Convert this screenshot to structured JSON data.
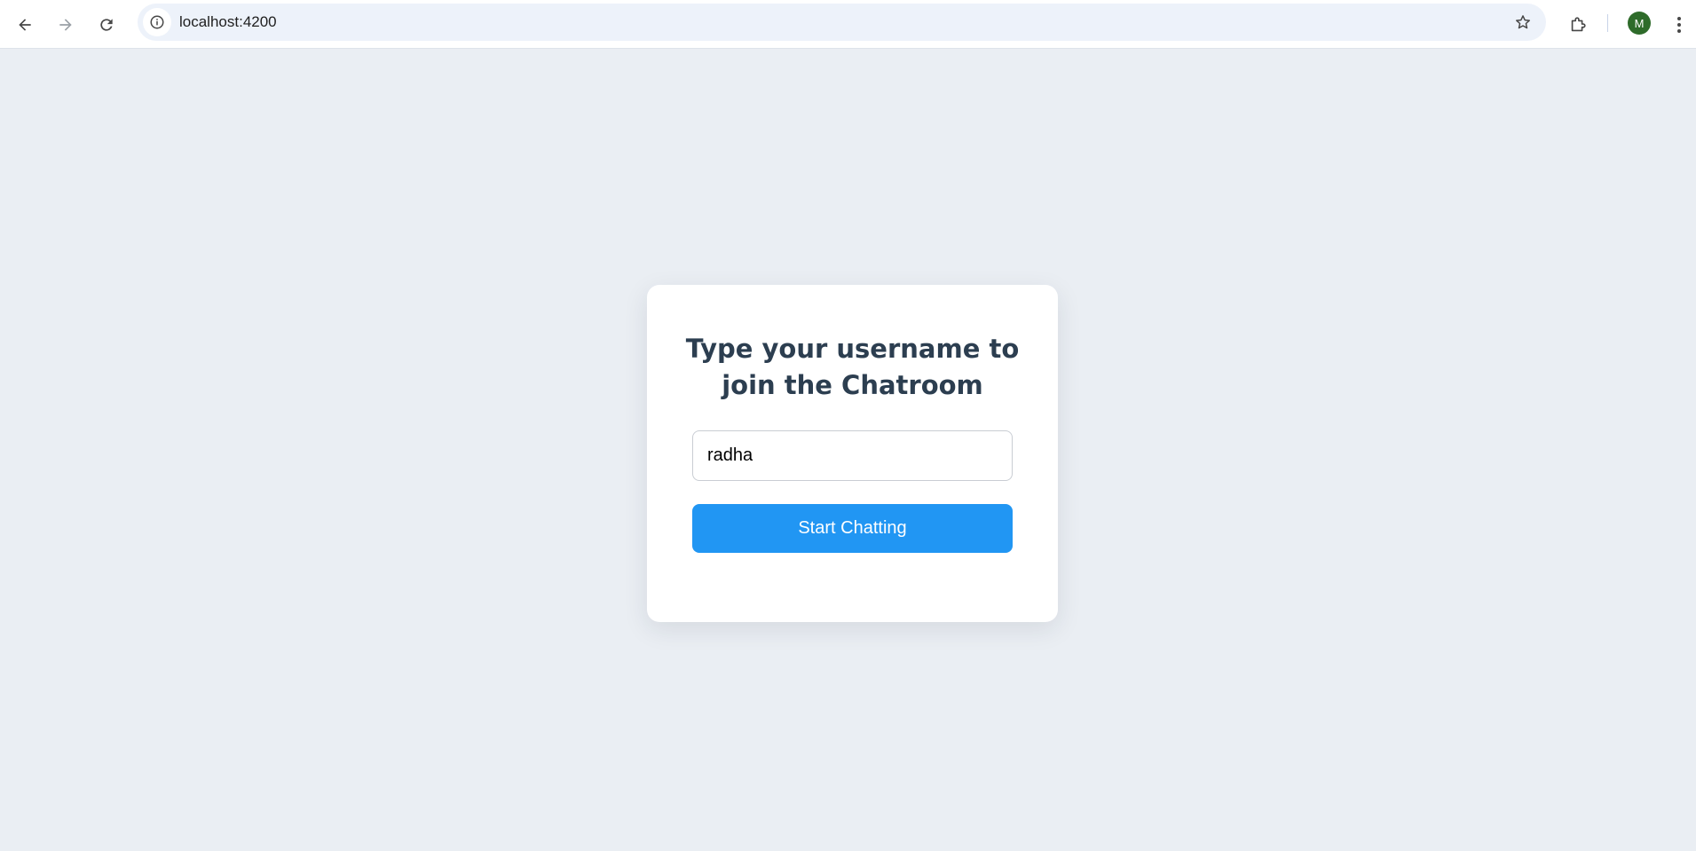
{
  "browser": {
    "url": "localhost:4200",
    "profile_initial": "M",
    "icons": {
      "back": "arrow-left-icon",
      "forward": "arrow-right-icon",
      "reload": "reload-icon",
      "site_info": "info-icon",
      "bookmark": "star-icon",
      "extensions": "puzzle-icon",
      "menu": "kebab-menu-icon"
    }
  },
  "login": {
    "title": "Type your username to join the Chatroom",
    "username_value": "radha",
    "button_label": "Start Chatting"
  },
  "colors": {
    "page_background": "#eaeef3",
    "card_background": "#ffffff",
    "title_color": "#2c3e50",
    "button_background": "#2196f3",
    "button_text": "#ffffff",
    "avatar_background": "#2e6b2a"
  }
}
